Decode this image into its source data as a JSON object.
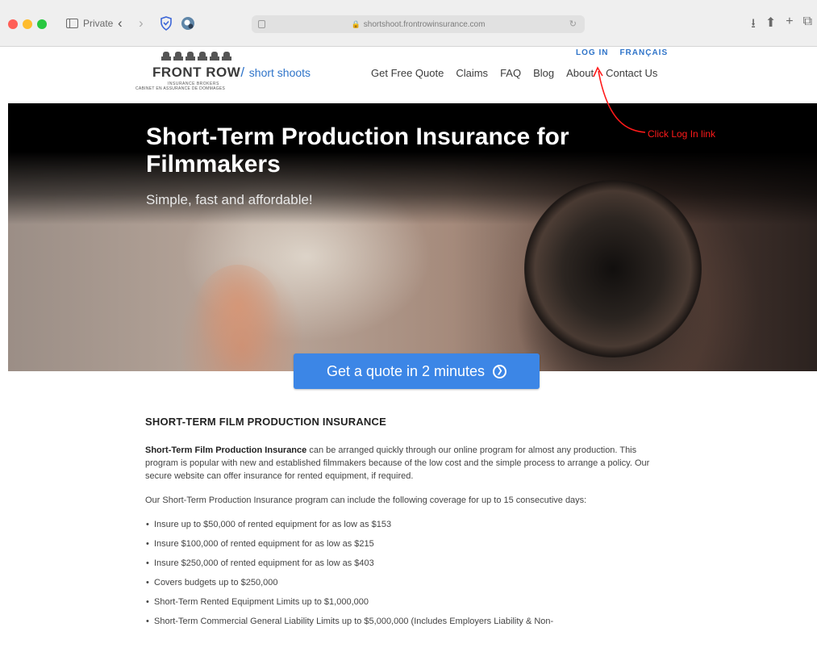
{
  "browser": {
    "private_label": "Private",
    "url": "shortshoot.frontrowinsurance.com"
  },
  "header": {
    "logo": {
      "brand": "FRONT ROW",
      "slash": "/",
      "sub": "short shoots",
      "tagline1": "INSURANCE BROKERS",
      "tagline2": "CABINET EN ASSURANCE DE DOMMAGES"
    },
    "utility": {
      "login": "LOG IN",
      "french": "FRANÇAIS"
    },
    "nav": [
      "Get Free Quote",
      "Claims",
      "FAQ",
      "Blog",
      "About",
      "Contact Us"
    ]
  },
  "hero": {
    "title": "Short-Term Production Insurance for Filmmakers",
    "subtitle": "Simple, fast and affordable!",
    "cta": "Get a quote in 2 minutes"
  },
  "annotation": {
    "text": "Click Log In link",
    "color": "#ff1a1a"
  },
  "content": {
    "heading": "SHORT-TERM FILM PRODUCTION INSURANCE",
    "intro_bold": "Short-Term Film Production Insurance",
    "intro_rest": " can be arranged quickly through our online program for almost any production. This program is popular with new and established filmmakers because of the low cost and the simple process to arrange a policy. Our secure website can offer insurance for rented equipment, if required.",
    "coverage_intro": "Our Short-Term Production Insurance program can include the following coverage for up to 15 consecutive days:",
    "bullets": [
      "Insure up to $50,000 of rented equipment for as low as $153",
      "Insure $100,000 of rented equipment for as low as $215",
      "Insure $250,000 of rented equipment for as low as $403",
      "Covers budgets up to $250,000",
      "Short-Term Rented Equipment Limits up to $1,000,000",
      "Short-Term Commercial General Liability Limits up to $5,000,000 (Includes Employers Liability & Non-"
    ]
  },
  "colors": {
    "accent": "#2f74c9",
    "cta": "#3c86e6"
  }
}
